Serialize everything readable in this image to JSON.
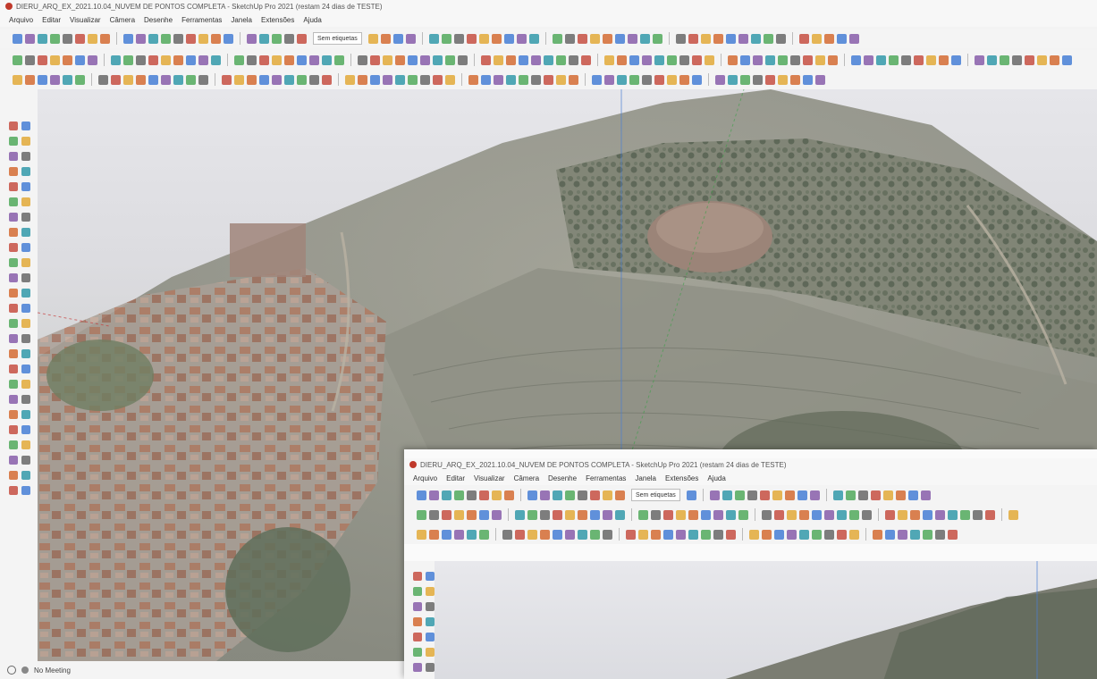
{
  "main": {
    "title": "DIERU_ARQ_EX_2021.10.04_NUVEM DE PONTOS COMPLETA - SketchUp Pro 2021 (restam 24 dias de TESTE)",
    "menu": [
      "Arquivo",
      "Editar",
      "Visualizar",
      "Câmera",
      "Desenhe",
      "Ferramentas",
      "Janela",
      "Extensões",
      "Ajuda"
    ],
    "tag_select": "Sem etiquetas",
    "status_text": "No Meeting"
  },
  "inset": {
    "title": "DIERU_ARQ_EX_2021.10.04_NUVEM DE PONTOS COMPLETA - SketchUp Pro 2021 (restam 24 dias de TESTE)",
    "menu": [
      "Arquivo",
      "Editar",
      "Visualizar",
      "Câmera",
      "Desenhe",
      "Ferramentas",
      "Janela",
      "Extensões",
      "Ajuda"
    ],
    "tag_select": "Sem etiquetas"
  },
  "colors": {
    "axis_blue": "#4a7fd4",
    "axis_green": "#3ca048",
    "axis_red": "#c84040",
    "terrain_grey": "#8a8a80",
    "roof_terracotta": "#b07a62",
    "vegetation": "#5f6e5a"
  }
}
